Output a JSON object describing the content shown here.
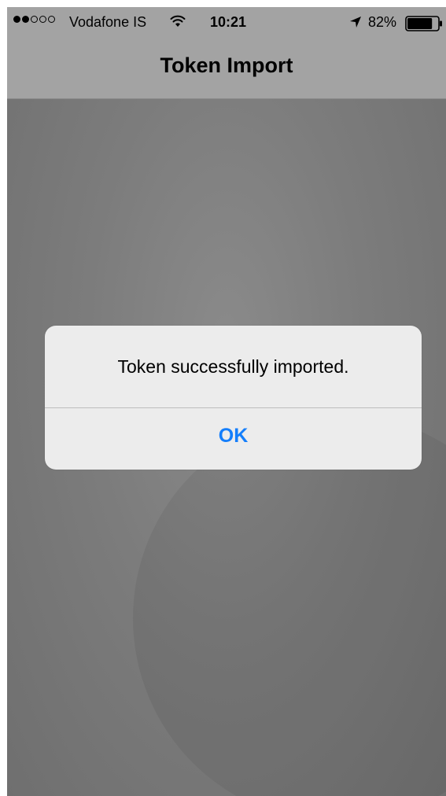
{
  "status_bar": {
    "signal_filled": 2,
    "signal_total": 5,
    "carrier": "Vodafone IS",
    "time": "10:21",
    "battery_percent": "82%",
    "battery_level": 0.82,
    "icons": [
      "wifi-icon",
      "location-arrow-icon",
      "battery-icon"
    ]
  },
  "nav": {
    "title": "Token Import"
  },
  "alert": {
    "message": "Token successfully imported.",
    "ok_label": "OK"
  },
  "colors": {
    "bars": "#a3a3a3",
    "background": "#7b7b7b",
    "alert_bg": "#ececec",
    "button_text": "#147efb"
  }
}
